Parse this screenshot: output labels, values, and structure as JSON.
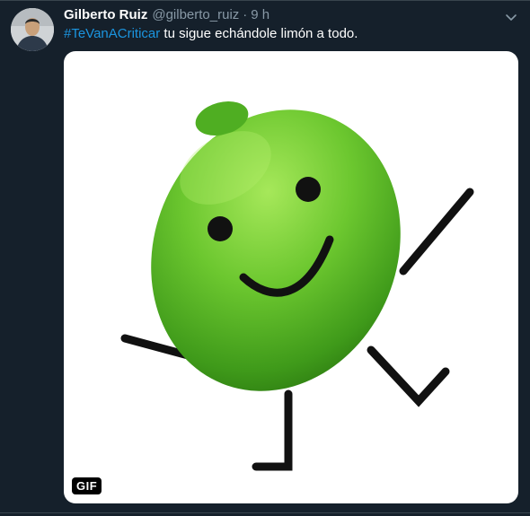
{
  "tweet": {
    "display_name": "Gilberto Ruiz",
    "handle": "@gilberto_ruiz",
    "separator": "·",
    "time": "9 h",
    "hashtag": "#TeVanACriticar",
    "text": " tu sigue echándole limón a todo.",
    "media_badge": "GIF"
  },
  "icons": {
    "menu": "chevron-down-icon",
    "avatar": "avatar"
  },
  "colors": {
    "background": "#15202b",
    "hashtag": "#1b95e0",
    "muted": "#8899a6",
    "lime": "#6cc72f"
  }
}
